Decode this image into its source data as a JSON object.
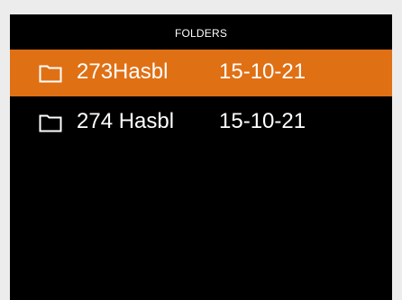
{
  "header": {
    "title": "FOLDERS"
  },
  "colors": {
    "screen_background": "#000000",
    "selected_row": "#e07014",
    "text": "#ffffff",
    "bezel": "#ececec"
  },
  "folders": [
    {
      "icon": "folder-icon",
      "name": "273Hasbl",
      "date": "15-10-21",
      "selected": true
    },
    {
      "icon": "folder-icon",
      "name": "274 Hasbl",
      "date": "15-10-21",
      "selected": false
    }
  ]
}
